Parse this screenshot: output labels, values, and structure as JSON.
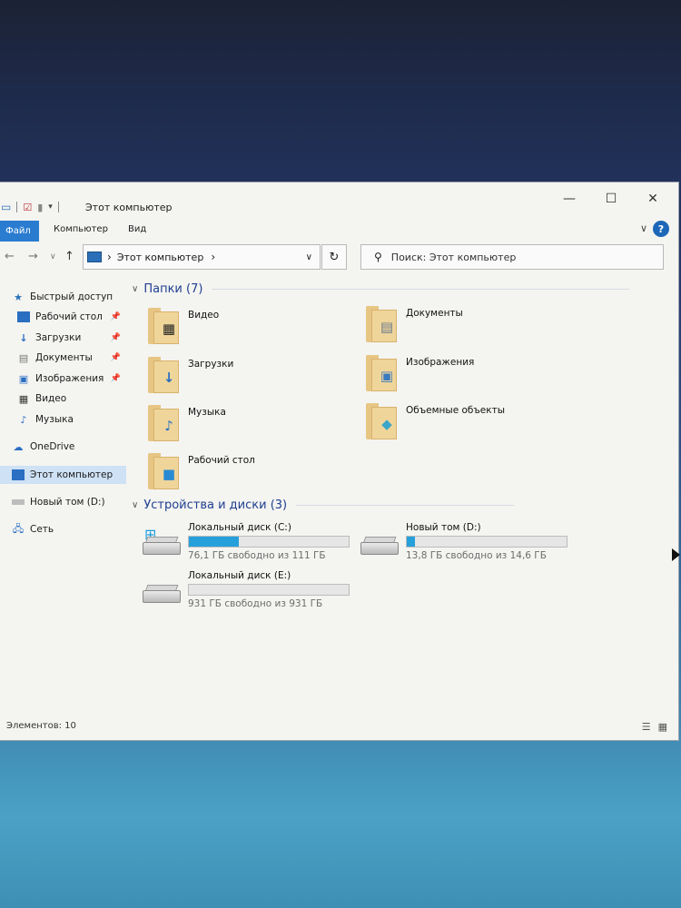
{
  "window": {
    "title": "Этот компьютер",
    "controls": {
      "minimize": "—",
      "maximize": "☐",
      "close": "✕"
    }
  },
  "ribbon": {
    "tabs": [
      "Файл",
      "Компьютер",
      "Вид"
    ],
    "help": "?",
    "expand": "∨"
  },
  "nav": {
    "address_text": "Этот компьютер",
    "address_sep": "›",
    "search_placeholder": "Поиск: Этот компьютер"
  },
  "sidebar": {
    "items": [
      {
        "label": "Быстрый доступ",
        "icon": "star-icon",
        "pinned": false
      },
      {
        "label": "Рабочий стол",
        "icon": "desktop-icon",
        "pinned": true
      },
      {
        "label": "Загрузки",
        "icon": "download-icon",
        "pinned": true
      },
      {
        "label": "Документы",
        "icon": "document-icon",
        "pinned": true
      },
      {
        "label": "Изображения",
        "icon": "picture-icon",
        "pinned": true
      },
      {
        "label": "Видео",
        "icon": "video-icon",
        "pinned": false
      },
      {
        "label": "Музыка",
        "icon": "music-icon",
        "pinned": false
      },
      {
        "label": "OneDrive",
        "icon": "cloud-icon",
        "pinned": false
      },
      {
        "label": "Этот компьютер",
        "icon": "computer-icon",
        "pinned": false
      },
      {
        "label": "Новый том (D:)",
        "icon": "drive-icon",
        "pinned": false
      },
      {
        "label": "Сеть",
        "icon": "network-icon",
        "pinned": false
      }
    ]
  },
  "folders_section": {
    "title": "Папки (7)",
    "items": [
      {
        "label": "Видео",
        "icon": "video-folder-icon"
      },
      {
        "label": "Документы",
        "icon": "documents-folder-icon"
      },
      {
        "label": "Загрузки",
        "icon": "downloads-folder-icon"
      },
      {
        "label": "Изображения",
        "icon": "pictures-folder-icon"
      },
      {
        "label": "Музыка",
        "icon": "music-folder-icon"
      },
      {
        "label": "Объемные объекты",
        "icon": "3d-objects-folder-icon"
      },
      {
        "label": "Рабочий стол",
        "icon": "desktop-folder-icon"
      }
    ]
  },
  "drives_section": {
    "title": "Устройства и диски (3)",
    "drives": [
      {
        "name": "Локальный диск (C:)",
        "free_text": "76,1 ГБ свободно из 111 ГБ",
        "used_fraction": 0.31
      },
      {
        "name": "Новый том (D:)",
        "free_text": "13,8 ГБ свободно из 14,6 ГБ",
        "used_fraction": 0.05
      },
      {
        "name": "Локальный диск (E:)",
        "free_text": "931 ГБ свободно из 931 ГБ",
        "used_fraction": 0.0
      }
    ]
  },
  "status": {
    "items_text": "Элементов: 10"
  },
  "colors": {
    "accent": "#2a7cd1",
    "bar_fill": "#26a0da",
    "section_title": "#1e3f8f"
  }
}
